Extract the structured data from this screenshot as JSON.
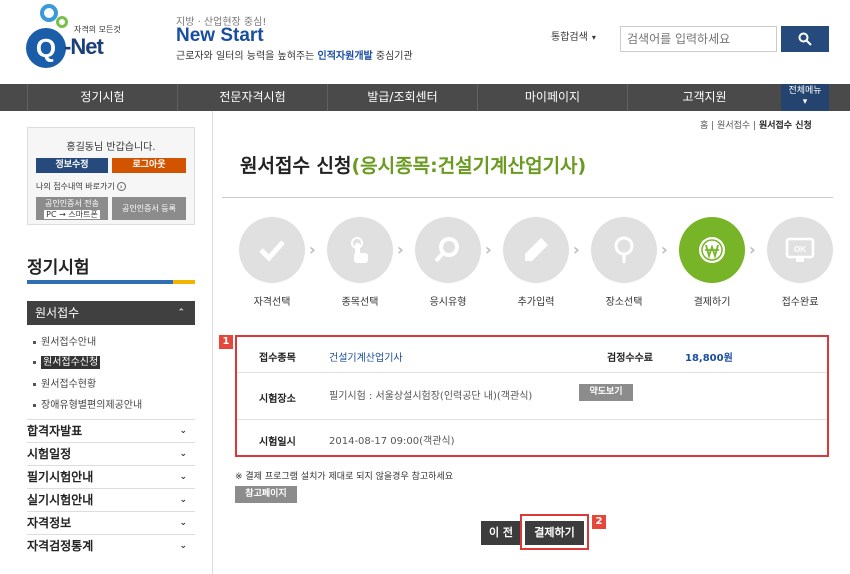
{
  "header": {
    "logo_tagline": "자격의 모든것",
    "logo_brand": "Q-Net",
    "slogan_small": "지방 · 산업현장 중심!",
    "slogan_big": "New Start",
    "slogan_desc_pre": "근로자와 일터의 능력을 높혀주는 ",
    "slogan_desc_hl": "인적자원개발",
    "slogan_desc_post": " 중심기관",
    "search_scope": "통합검색",
    "search_placeholder": "검색어를 입력하세요"
  },
  "gnb": {
    "items": [
      "정기시험",
      "전문자격시험",
      "발급/조회센터",
      "마이페이지",
      "고객지원"
    ],
    "all_menu": "전체메뉴"
  },
  "login": {
    "greeting": "홍길동님 반갑습니다.",
    "edit_info": "정보수정",
    "logout": "로그아웃",
    "my_link": "나의 접수내역 바로가기",
    "cert_send_line1": "공인인증서 전송",
    "cert_send_line2": "PC → 스마트폰",
    "cert_register": "공인인증서 등록"
  },
  "sidebar": {
    "title": "정기시험",
    "active_menu": "원서접수",
    "sub_items": [
      "원서접수안내",
      "원서접수신청",
      "원서접수현황",
      "장애유형별편의제공안내"
    ],
    "menu_items": [
      "합격자발표",
      "시험일정",
      "필기시험안내",
      "실기시험안내",
      "자격정보",
      "자격검정통계"
    ]
  },
  "main": {
    "breadcrumb_home": "홈",
    "breadcrumb_mid": "원서접수",
    "breadcrumb_current": "원서접수 신청",
    "title_main": "원서접수 신청",
    "title_sub": "(응시종목:건설기계산업기사)",
    "steps": [
      "자격선택",
      "종목선택",
      "응시유형",
      "추가입력",
      "장소선택",
      "결제하기",
      "접수완료"
    ],
    "active_step": 6
  },
  "form": {
    "badge": "1",
    "field_label": "접수종목",
    "field_value": "건설기계산업기사",
    "fee_label": "검정수수료",
    "fee_value": "18,800원",
    "place_label": "시험장소",
    "place_value": "필기시험 : 서울상설시험장(인력공단 내)(객관식)",
    "map_button": "약도보기",
    "date_label": "시험일시",
    "date_value": "2014-08-17 09:00(객관식)"
  },
  "notice": "※ 결제 프로그램 설치가 제대로 되지 않을경우 참고하세요",
  "ref_button": "참고페이지",
  "prev_button": "이 전",
  "pay_button": "결제하기",
  "badge2": "2",
  "colors": {
    "accent_blue": "#1a4fa0",
    "active_green": "#78b427",
    "highlight_red": "#d83a3a",
    "gnb_bg": "#4a4a4a"
  }
}
